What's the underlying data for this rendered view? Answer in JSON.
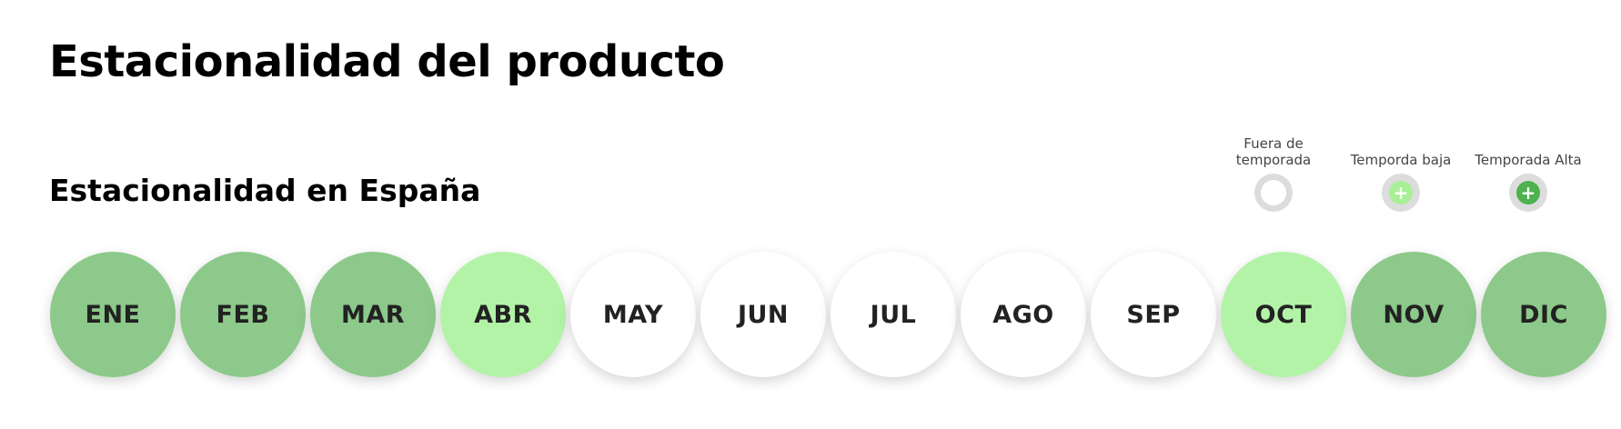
{
  "title": "Estacionalidad del producto",
  "subtitle": "Estacionalidad en España",
  "colors": {
    "fuera": "#ffffff",
    "baja": "#b3f3a8",
    "alta": "#8cc98a",
    "baja_icon": "#a8ef95",
    "alta_icon": "#4db24d"
  },
  "legend": [
    {
      "label": "Fuera de temporada",
      "icon": "empty-circle-icon"
    },
    {
      "label": "Temporda baja",
      "icon": "plus-icon",
      "symbol": "+"
    },
    {
      "label": "Temporada Alta",
      "icon": "plus-icon",
      "symbol": "+"
    }
  ],
  "months": [
    {
      "label": "ENE",
      "season": "alta"
    },
    {
      "label": "FEB",
      "season": "alta"
    },
    {
      "label": "MAR",
      "season": "alta"
    },
    {
      "label": "ABR",
      "season": "baja"
    },
    {
      "label": "MAY",
      "season": "fuera"
    },
    {
      "label": "JUN",
      "season": "fuera"
    },
    {
      "label": "JUL",
      "season": "fuera"
    },
    {
      "label": "AGO",
      "season": "fuera"
    },
    {
      "label": "SEP",
      "season": "fuera"
    },
    {
      "label": "OCT",
      "season": "baja"
    },
    {
      "label": "NOV",
      "season": "alta"
    },
    {
      "label": "DIC",
      "season": "alta"
    }
  ]
}
